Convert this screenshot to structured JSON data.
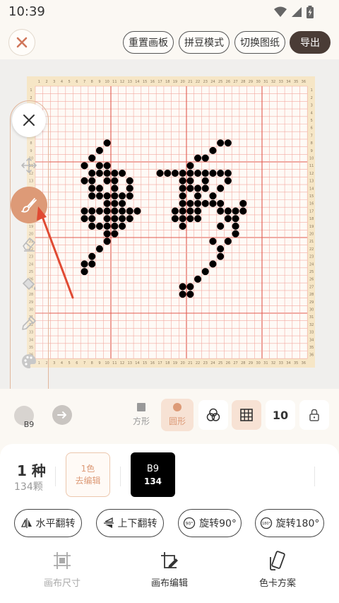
{
  "status_bar": {
    "time": "10:39"
  },
  "top_bar": {
    "buttons": [
      "重置画板",
      "拼豆模式",
      "切换图纸"
    ],
    "export_label": "导出"
  },
  "grid": {
    "size": 36,
    "ruler_labels": [
      "1",
      "2",
      "3",
      "4",
      "5",
      "6",
      "7",
      "8",
      "9",
      "10",
      "11",
      "12",
      "13",
      "14",
      "15",
      "16",
      "17",
      "18",
      "19",
      "20",
      "21",
      "22",
      "23",
      "24",
      "25",
      "26",
      "27",
      "28",
      "29",
      "30",
      "31",
      "32",
      "33",
      "34",
      "35",
      "36"
    ],
    "major_every": 10,
    "beads": [
      [
        10,
        8
      ],
      [
        9,
        9
      ],
      [
        8,
        10
      ],
      [
        7,
        11
      ],
      [
        9,
        11
      ],
      [
        10,
        11
      ],
      [
        8,
        12
      ],
      [
        9,
        12
      ],
      [
        10,
        12
      ],
      [
        11,
        12
      ],
      [
        12,
        12
      ],
      [
        7,
        13
      ],
      [
        8,
        13
      ],
      [
        10,
        13
      ],
      [
        11,
        13
      ],
      [
        13,
        13
      ],
      [
        8,
        14
      ],
      [
        9,
        14
      ],
      [
        11,
        14
      ],
      [
        13,
        14
      ],
      [
        8,
        15
      ],
      [
        9,
        15
      ],
      [
        10,
        15
      ],
      [
        11,
        15
      ],
      [
        12,
        15
      ],
      [
        13,
        15
      ],
      [
        10,
        16
      ],
      [
        11,
        16
      ],
      [
        12,
        16
      ],
      [
        7,
        17
      ],
      [
        8,
        17
      ],
      [
        9,
        17
      ],
      [
        10,
        17
      ],
      [
        11,
        17
      ],
      [
        12,
        17
      ],
      [
        13,
        17
      ],
      [
        14,
        17
      ],
      [
        7,
        18
      ],
      [
        8,
        18
      ],
      [
        10,
        18
      ],
      [
        11,
        18
      ],
      [
        12,
        18
      ],
      [
        13,
        18
      ],
      [
        8,
        19
      ],
      [
        9,
        19
      ],
      [
        10,
        19
      ],
      [
        11,
        19
      ],
      [
        12,
        19
      ],
      [
        10,
        20
      ],
      [
        11,
        20
      ],
      [
        10,
        21
      ],
      [
        9,
        22
      ],
      [
        8,
        23
      ],
      [
        7,
        24
      ],
      [
        8,
        24
      ],
      [
        7,
        25
      ],
      [
        25,
        8
      ],
      [
        26,
        8
      ],
      [
        24,
        9
      ],
      [
        22,
        10
      ],
      [
        23,
        10
      ],
      [
        21,
        11
      ],
      [
        17,
        12
      ],
      [
        18,
        12
      ],
      [
        19,
        12
      ],
      [
        20,
        12
      ],
      [
        21,
        12
      ],
      [
        22,
        12
      ],
      [
        23,
        12
      ],
      [
        24,
        12
      ],
      [
        25,
        12
      ],
      [
        26,
        12
      ],
      [
        20,
        13
      ],
      [
        21,
        13
      ],
      [
        23,
        13
      ],
      [
        26,
        13
      ],
      [
        20,
        14
      ],
      [
        21,
        14
      ],
      [
        22,
        14
      ],
      [
        23,
        14
      ],
      [
        25,
        14
      ],
      [
        20,
        15
      ],
      [
        22,
        15
      ],
      [
        24,
        15
      ],
      [
        20,
        16
      ],
      [
        21,
        16
      ],
      [
        22,
        16
      ],
      [
        23,
        16
      ],
      [
        24,
        16
      ],
      [
        25,
        16
      ],
      [
        28,
        16
      ],
      [
        19,
        17
      ],
      [
        20,
        17
      ],
      [
        21,
        17
      ],
      [
        22,
        17
      ],
      [
        25,
        17
      ],
      [
        26,
        17
      ],
      [
        27,
        17
      ],
      [
        28,
        17
      ],
      [
        19,
        18
      ],
      [
        20,
        18
      ],
      [
        21,
        18
      ],
      [
        22,
        18
      ],
      [
        26,
        18
      ],
      [
        27,
        18
      ],
      [
        20,
        19
      ],
      [
        25,
        19
      ],
      [
        27,
        19
      ],
      [
        27,
        20
      ],
      [
        24,
        21
      ],
      [
        26,
        21
      ],
      [
        25,
        22
      ],
      [
        25,
        23
      ],
      [
        24,
        24
      ],
      [
        23,
        25
      ],
      [
        22,
        26
      ],
      [
        20,
        27
      ],
      [
        21,
        27
      ],
      [
        20,
        28
      ],
      [
        21,
        28
      ]
    ]
  },
  "side_toolbar": {
    "tools": [
      "close-icon",
      "move-icon",
      "brush-icon",
      "eraser-icon",
      "bucket-icon",
      "eyedropper-icon",
      "palette-icon"
    ],
    "current_color": "B9",
    "current_color_hex": "#000000"
  },
  "controls": {
    "square_label": "方形",
    "circle_label": "圆形",
    "zoom_value": "10"
  },
  "color_panel": {
    "count": "1 种",
    "beads_total": "134颗",
    "edit_line1": "1色",
    "edit_line2": "去编辑",
    "color_code": "B9",
    "color_count": "134",
    "actions": [
      "水平翻转",
      "上下翻转",
      "旋转90°",
      "旋转180°"
    ]
  },
  "bottom_nav": {
    "items": [
      "画布尺寸",
      "画布编辑",
      "色卡方案"
    ],
    "active": "画布编辑"
  },
  "colors": {
    "accent": "#dd9a77",
    "export_bg": "#4a3c36",
    "grid_line": "#f3a9a1",
    "grid_major": "#e25a50",
    "bead": "#000000",
    "board": "#f6e6c6",
    "annotation_arrow": "#e04a33"
  }
}
